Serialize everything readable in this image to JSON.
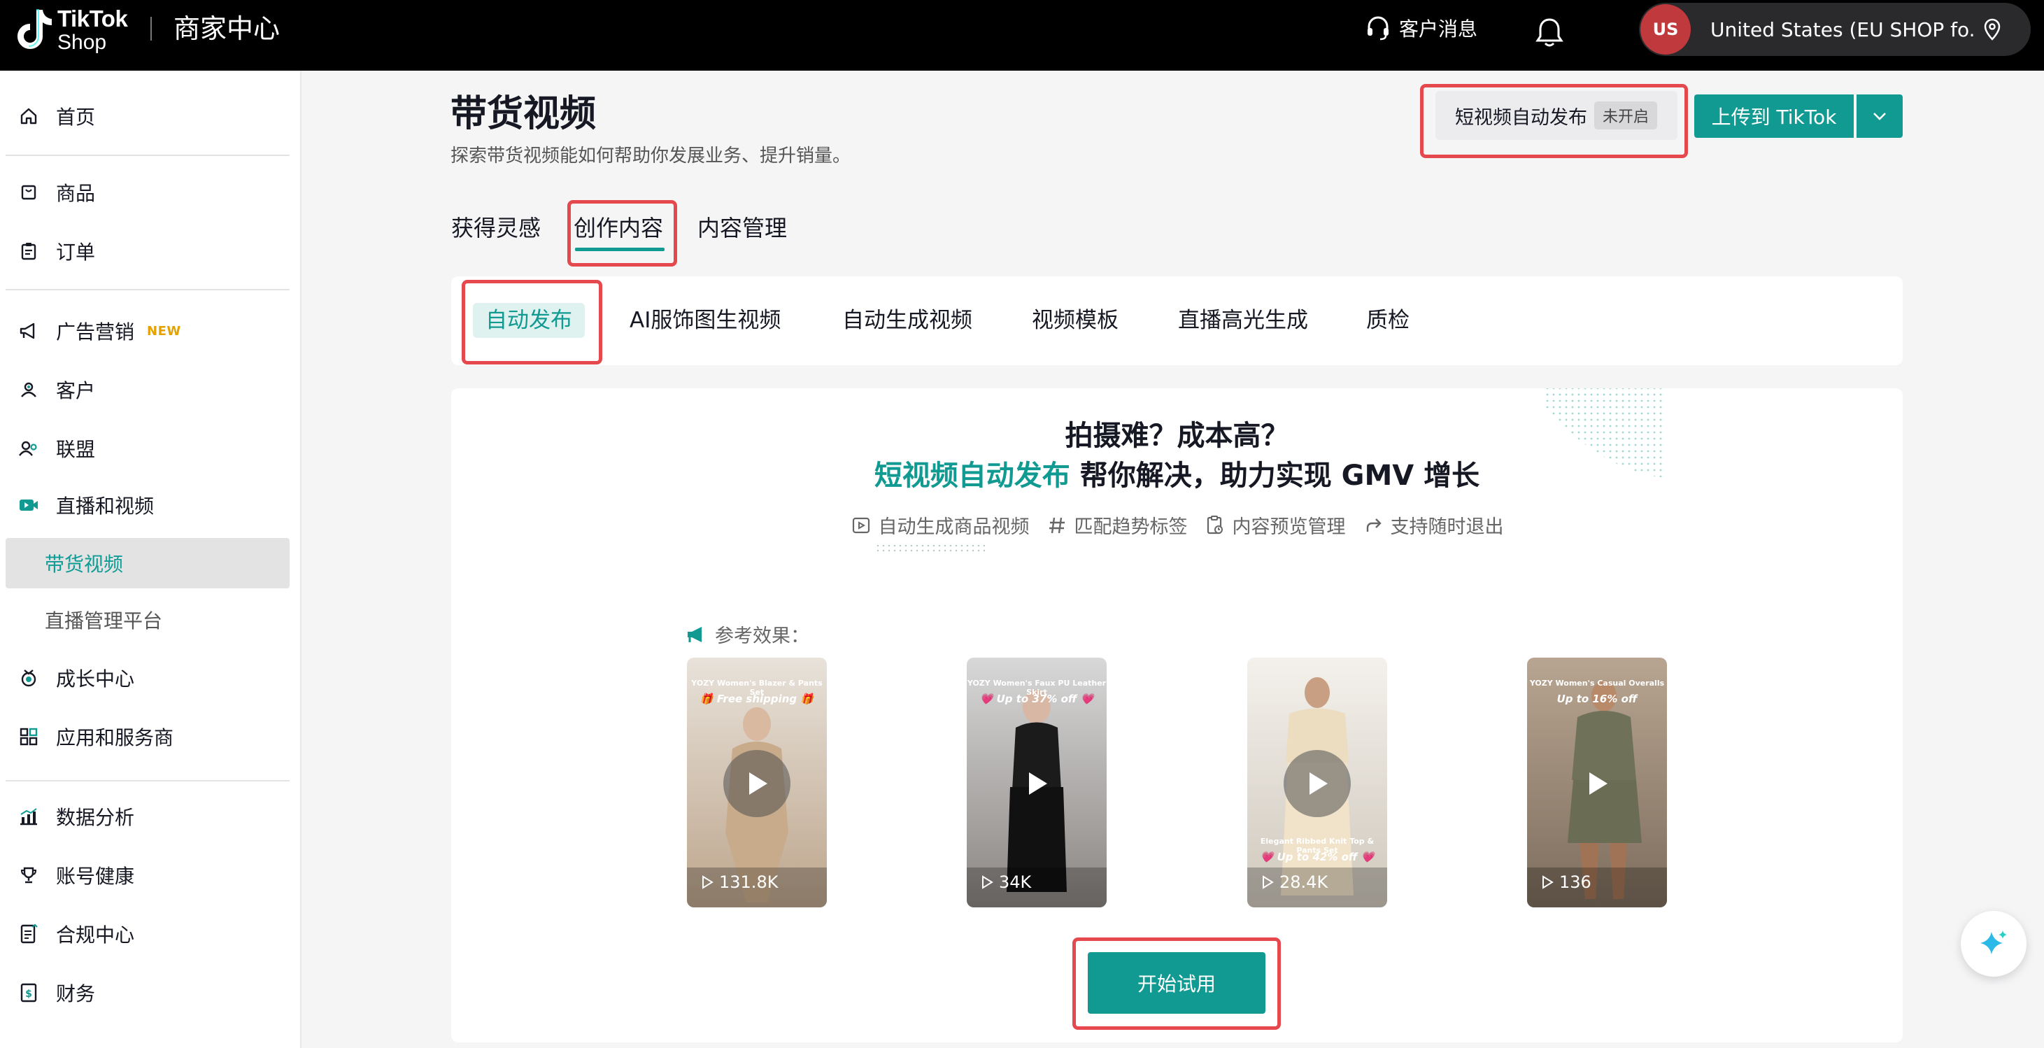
{
  "header": {
    "logo_line1": "TikTok",
    "logo_line2": "Shop",
    "title": "商家中心",
    "customer_messages": "客户消息",
    "region_avatar": "US",
    "region_label": "United States  (EU SHOP fo..."
  },
  "sidebar": {
    "items": [
      {
        "label": "首页",
        "icon": "home-icon"
      },
      {
        "label": "商品",
        "icon": "product-icon"
      },
      {
        "label": "订单",
        "icon": "order-icon"
      },
      {
        "label": "广告营销",
        "icon": "megaphone-icon",
        "badge": "NEW"
      },
      {
        "label": "客户",
        "icon": "customers-icon"
      },
      {
        "label": "联盟",
        "icon": "affiliate-icon"
      },
      {
        "label": "直播和视频",
        "icon": "video-icon"
      },
      {
        "label": "带货视频",
        "sub": true,
        "active": true
      },
      {
        "label": "直播管理平台",
        "sub": true
      },
      {
        "label": "成长中心",
        "icon": "growth-icon"
      },
      {
        "label": "应用和服务商",
        "icon": "apps-icon"
      },
      {
        "label": "数据分析",
        "icon": "analytics-icon"
      },
      {
        "label": "账号健康",
        "icon": "trophy-icon"
      },
      {
        "label": "合规中心",
        "icon": "compliance-icon"
      },
      {
        "label": "财务",
        "icon": "finance-icon"
      }
    ]
  },
  "page": {
    "title": "带货视频",
    "subtitle": "探索带货视频能如何帮助你发展业务、提升销量。",
    "auto_publish_label": "短视频自动发布",
    "auto_publish_status": "未开启",
    "upload_label": "上传到 TikTok"
  },
  "tabs": [
    "获得灵感",
    "创作内容",
    "内容管理"
  ],
  "subtabs": [
    "自动发布",
    "AI服饰图生视频",
    "自动生成视频",
    "视频模板",
    "直播高光生成",
    "质检"
  ],
  "panel": {
    "hero_line1": "拍摄难？成本高？",
    "hero_accent": "短视频自动发布",
    "hero_line2_rest": " 帮你解决，助力实现 GMV 增长",
    "features": [
      "自动生成商品视频",
      "匹配趋势标签",
      "内容预览管理",
      "支持随时退出"
    ],
    "reference_label": "参考效果：",
    "videos": [
      {
        "banner": "YOZY Women's Blazer & Pants Set",
        "promo": "🎁 Free shipping 🎁",
        "views": "131.8K",
        "color": "#c9b9a6"
      },
      {
        "banner": "YOZY Women's Faux PU Leather Skirt",
        "promo": "💗 Up to 37% off 💗",
        "views": "34K",
        "color": "#6e6a66"
      },
      {
        "banner": "Elegant Ribbed Knit Top & Pants Set",
        "promo": "💗 Up to 42% off 💗",
        "views": "28.4K",
        "color": "#d9d4cb"
      },
      {
        "banner": "YOZY Women's Casual Overalls",
        "promo": "Up to 16% off",
        "views": "136",
        "color": "#8e8a7a"
      }
    ],
    "start_button": "开始试用"
  },
  "colors": {
    "accent": "#109a92",
    "highlight": "#e5484d"
  }
}
